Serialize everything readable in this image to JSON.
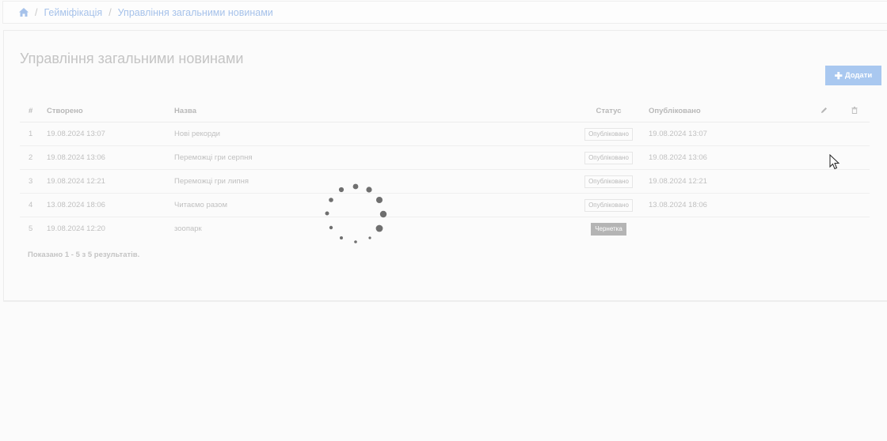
{
  "breadcrumb": {
    "home_icon": "home-icon",
    "separator": "/",
    "items": [
      "Гейміфікація",
      "Управління загальними новинами"
    ]
  },
  "page": {
    "title": "Управління загальними новинами",
    "add_button_label": "Додати"
  },
  "table": {
    "headers": {
      "num": "#",
      "created": "Створено",
      "title": "Назва",
      "status": "Статус",
      "published": "Опубліковано",
      "edit_icon": "pencil-icon",
      "delete_icon": "trash-icon"
    },
    "rows": [
      {
        "num": "1",
        "created": "19.08.2024 13:07",
        "title": "Нові рекорди",
        "status": "Опубліковано",
        "published": "19.08.2024 13:07"
      },
      {
        "num": "2",
        "created": "19.08.2024 13:06",
        "title": "Переможці гри серпня",
        "status": "Опубліковано",
        "published": "19.08.2024 13:06"
      },
      {
        "num": "3",
        "created": "19.08.2024 12:21",
        "title": "Переможці гри липня",
        "status": "Опубліковано",
        "published": "19.08.2024 12:21"
      },
      {
        "num": "4",
        "created": "13.08.2024 18:06",
        "title": "Читаємо разом",
        "status": "Опубліковано",
        "published": "13.08.2024 18:06"
      },
      {
        "num": "5",
        "created": "19.08.2024 12:20",
        "title": "зоопарк",
        "status": "Чернетка",
        "published": ""
      }
    ]
  },
  "summary": "Показано 1 - 5 з 5 результатів.",
  "colors": {
    "accent": "#a9c8f0",
    "link": "#a6c2ea",
    "spinner": "#6f6f6f",
    "draft_badge": "#b4b4b4"
  }
}
